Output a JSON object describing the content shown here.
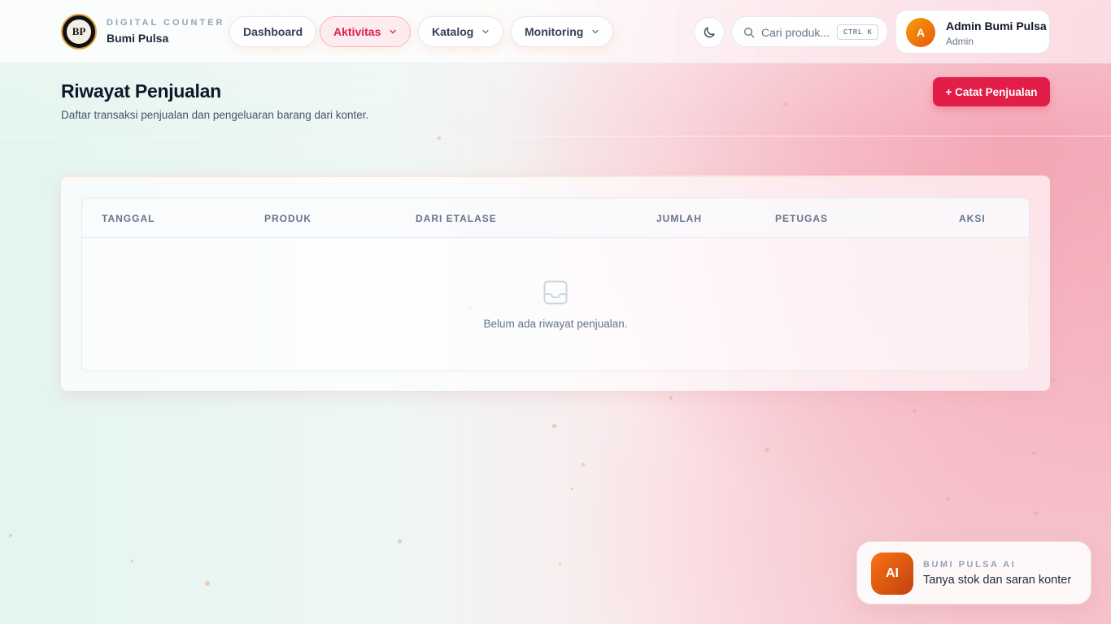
{
  "header": {
    "logo_text": "BP",
    "brand_kicker": "DIGITAL COUNTER",
    "brand_name": "Bumi Pulsa",
    "nav": [
      {
        "label": "Dashboard"
      },
      {
        "label": "Aktivitas"
      },
      {
        "label": "Katalog"
      },
      {
        "label": "Monitoring"
      }
    ],
    "search": {
      "placeholder": "Cari produk...",
      "shortcut": "CTRL K"
    },
    "user": {
      "avatar_initial": "A",
      "name": "Admin Bumi Pulsa",
      "role": "Admin"
    }
  },
  "page": {
    "title": "Riwayat Penjualan",
    "subtitle": "Daftar transaksi penjualan dan pengeluaran barang dari konter.",
    "primary_action": "+ Catat Penjualan"
  },
  "table": {
    "columns": [
      "TANGGAL",
      "PRODUK",
      "DARI ETALASE",
      "JUMLAH",
      "PETUGAS",
      "AKSI"
    ],
    "empty_message": "Belum ada riwayat penjualan."
  },
  "assistant": {
    "badge": "AI",
    "kicker": "BUMI PULSA AI",
    "prompt": "Tanya stok dan saran konter"
  },
  "colors": {
    "accent": "#e11d48",
    "ai_badge": "#f97316",
    "avatar": "#f59e0b"
  },
  "icons": [
    "moon-icon",
    "search-icon",
    "chevron-down-icon",
    "inbox-icon"
  ]
}
